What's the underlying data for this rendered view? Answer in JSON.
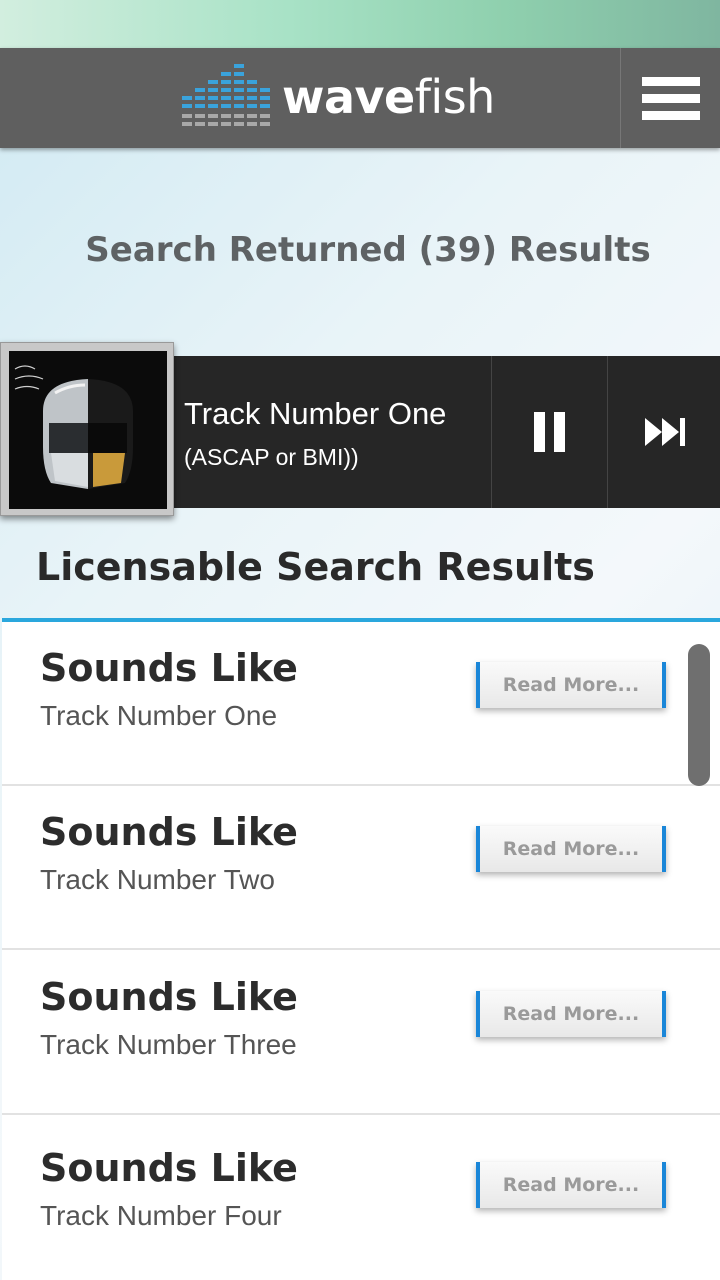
{
  "app": {
    "name_bold": "wave",
    "name_light": "fish",
    "menu_icon": "hamburger-menu-icon"
  },
  "search": {
    "results_summary": "Search Returned (39) Results"
  },
  "player": {
    "track_title": "Track Number One",
    "license": "(ASCAP or BMI))",
    "pause_icon": "pause-icon",
    "next_icon": "skip-next-icon",
    "album_art": "Random Access Memories"
  },
  "results": {
    "heading": "Licensable Search Results",
    "accent_color": "#2aa7dd",
    "items": [
      {
        "title": "Sounds Like",
        "subtitle": "Track Number One",
        "action": "Read More..."
      },
      {
        "title": "Sounds Like",
        "subtitle": "Track Number Two",
        "action": "Read More..."
      },
      {
        "title": "Sounds Like",
        "subtitle": "Track Number Three",
        "action": "Read More..."
      },
      {
        "title": "Sounds Like",
        "subtitle": "Track Number Four",
        "action": "Read More..."
      }
    ]
  }
}
